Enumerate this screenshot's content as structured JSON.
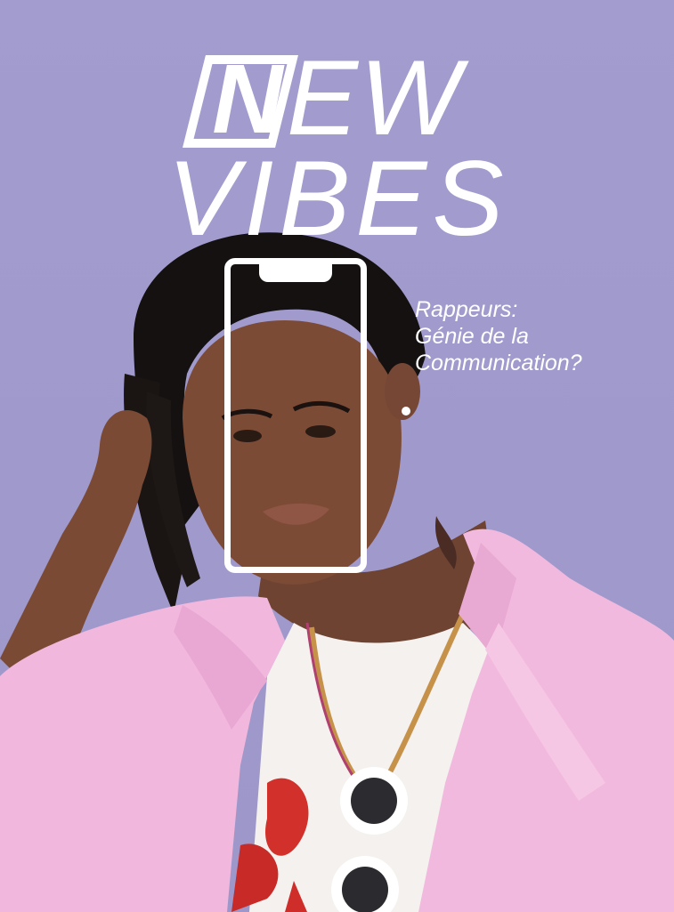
{
  "magazine": {
    "logo_letter": "N",
    "title_rest": "EW",
    "title_line2": "VIBES"
  },
  "headline": {
    "line1": "Rappeurs:",
    "line2": "Génie de la",
    "line3": "Communication?"
  },
  "colors": {
    "background": "#a19bcd",
    "jacket": "#f2b9de",
    "text": "#ffffff"
  }
}
